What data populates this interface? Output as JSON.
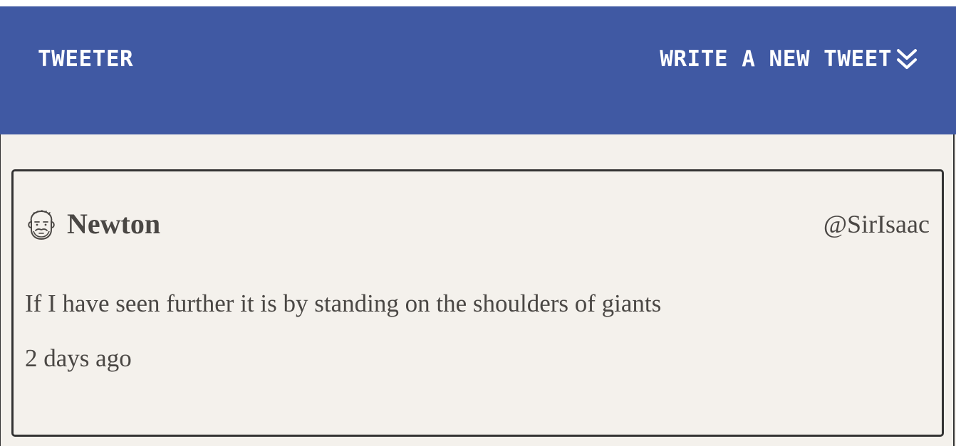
{
  "nav": {
    "brand": "TWEETER",
    "compose_label": "WRITE A NEW TWEET",
    "compose_icon": "double-chevron-down-icon"
  },
  "colors": {
    "nav_background": "#4059a3",
    "page_background": "#f4f1ec",
    "text": "#4a4744",
    "border": "#333333"
  },
  "tweet": {
    "avatar_icon": "bearded-man-avatar-icon",
    "name": "Newton",
    "handle": "@SirIsaac",
    "content": "If I have seen further it is by standing on the shoulders of giants",
    "time": "2 days ago"
  }
}
